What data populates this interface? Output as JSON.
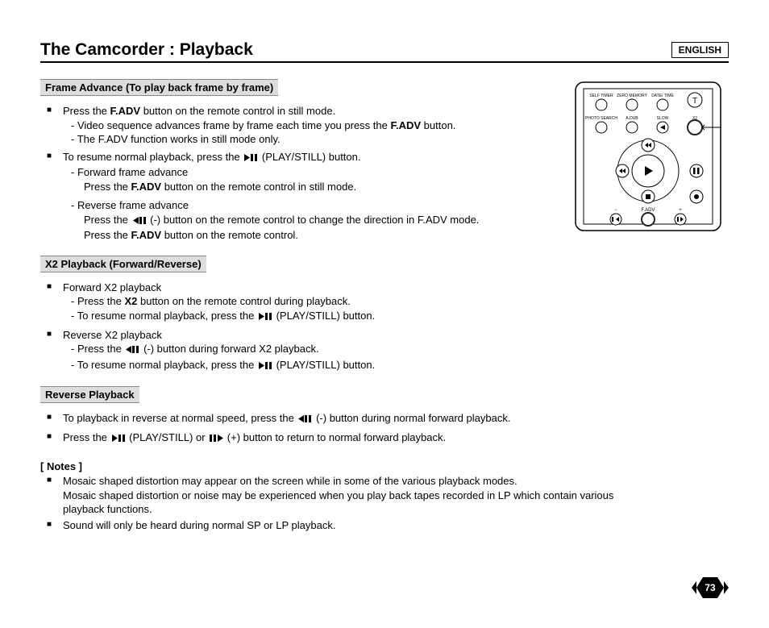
{
  "language_label": "ENGLISH",
  "page_title": "The Camcorder : Playback",
  "icons": {
    "play_still": "play-pause-icon",
    "rev_still": "rev-pause-icon",
    "fwd_step": "pause-fwd-icon"
  },
  "sections": {
    "frame_advance": {
      "label": "Frame Advance (To play back frame by frame)",
      "b1_pre": "Press the ",
      "b1_bold": "F.ADV",
      "b1_post": " button on the remote control in still mode.",
      "b1_s1_pre": "- Video sequence advances frame by frame each time you press the ",
      "b1_s1_bold": "F.ADV",
      "b1_s1_post": " button.",
      "b1_s2": "- The F.ADV function works in still mode only.",
      "b2_pre": "To resume normal playback, press the ",
      "b2_post": " (PLAY/STILL) button.",
      "b2_s1": "- Forward frame advance",
      "b2_s1d_pre": "Press the ",
      "b2_s1d_bold": "F.ADV",
      "b2_s1d_post": " button on the remote control in still mode.",
      "b2_s2": "- Reverse frame advance",
      "b2_s2d1_pre": "Press the ",
      "b2_s2d1_post": " (-) button on the remote control to change the direction in F.ADV mode.",
      "b2_s2d2_pre": "Press the ",
      "b2_s2d2_bold": "F.ADV",
      "b2_s2d2_post": " button on the remote control."
    },
    "x2": {
      "label": "X2 Playback (Forward/Reverse)",
      "b1": "Forward X2 playback",
      "b1_s1_pre": "- Press the ",
      "b1_s1_bold": "X2",
      "b1_s1_post": " button on the remote control during playback.",
      "b1_s2_pre": "- To resume normal playback, press the ",
      "b1_s2_post": " (PLAY/STILL) button.",
      "b2": "Reverse X2 playback",
      "b2_s1_pre": "- Press the ",
      "b2_s1_post": " (-) button during forward X2 playback.",
      "b2_s2_pre": "- To resume normal playback, press the ",
      "b2_s2_post": " (PLAY/STILL) button."
    },
    "reverse": {
      "label": "Reverse Playback",
      "b1_pre": "To playback in reverse at normal speed, press the ",
      "b1_post": " (-) button during normal forward playback.",
      "b2_pre": "Press the ",
      "b2_mid1": " (PLAY/STILL) or ",
      "b2_post": " (+) button to return to normal forward playback."
    }
  },
  "notes": {
    "header": "[ Notes ]",
    "n1a": "Mosaic shaped distortion may appear on the screen while in some of the various playback modes.",
    "n1b": "Mosaic shaped distortion or noise may be experienced when you play back tapes recorded in LP which contain various playback functions.",
    "n2": "Sound will only be heard during normal SP or LP playback."
  },
  "remote": {
    "labels": {
      "self_timer": "SELF TIMER",
      "zero_memory": "ZERO MEMORY",
      "date_time": "DATE/ TIME",
      "photo_search": "PHOTO SEARCH",
      "a_dub": "A.DUB",
      "slow": "SLOW",
      "x2": "X2",
      "f_adv": "F.ADV",
      "minus": "−",
      "plus": "+"
    }
  },
  "page_number": "73"
}
